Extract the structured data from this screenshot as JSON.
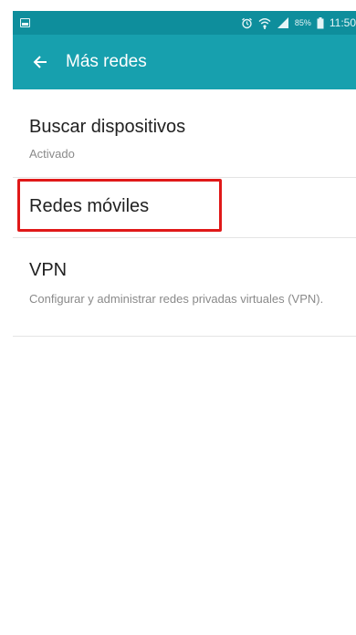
{
  "status_bar": {
    "battery_percent": "85%",
    "time": "11:50",
    "icons": [
      "gallery-icon",
      "alarm-icon",
      "wifi-icon",
      "signal-icon",
      "battery-icon"
    ]
  },
  "app_bar": {
    "title": "Más redes",
    "back_icon": "arrow-left-icon"
  },
  "items": [
    {
      "title": "Buscar dispositivos",
      "subtitle": "Activado"
    },
    {
      "title": "Redes móviles",
      "highlighted": true
    },
    {
      "title": "VPN",
      "subtitle": "Configurar y administrar redes privadas virtuales (VPN)."
    }
  ],
  "colors": {
    "status_bar": "#0e8e9c",
    "app_bar": "#17a0ae",
    "highlight": "#e01919"
  }
}
